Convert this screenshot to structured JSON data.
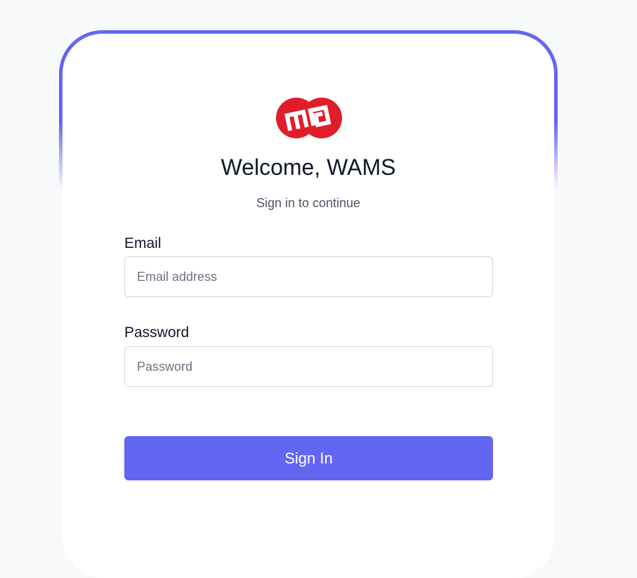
{
  "login": {
    "title": "Welcome, WAMS",
    "subtitle": "Sign in to continue",
    "email_label": "Email",
    "email_placeholder": "Email address",
    "email_value": "",
    "password_label": "Password",
    "password_placeholder": "Password",
    "password_value": "",
    "submit_label": "Sign In"
  },
  "logo": {
    "icon": "mb-logo-icon",
    "color": "#e11d2a"
  },
  "colors": {
    "accent": "#6366f1",
    "page_background": "#f8f9fb",
    "card_background": "#ffffff"
  }
}
